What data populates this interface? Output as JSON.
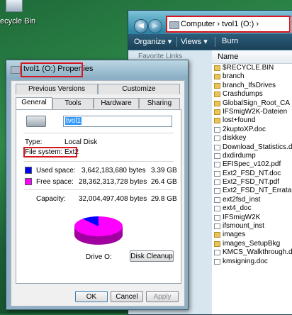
{
  "desktop": {
    "recycle_bin_label": "ecycle Bin"
  },
  "explorer": {
    "address_path": "Computer  ›  tvol1 (O:)  ›",
    "toolbar": {
      "organize": "Organize ▾",
      "views": "Views ▾",
      "burn": "Burn"
    },
    "favorite_links_label": "Favorite Links",
    "column_name": "Name",
    "files": [
      {
        "name": "$RECYCLE.BIN",
        "icon": "folder"
      },
      {
        "name": "branch",
        "icon": "folder"
      },
      {
        "name": "branch_IfsDrives",
        "icon": "folder"
      },
      {
        "name": "Crashdumps",
        "icon": "folder"
      },
      {
        "name": "GlobalSign_Root_CA",
        "icon": "folder"
      },
      {
        "name": "IFSmigW2K-Dateien",
        "icon": "folder"
      },
      {
        "name": "lost+found",
        "icon": "folder"
      },
      {
        "name": "2kuptoXP.doc",
        "icon": "doc"
      },
      {
        "name": "diskkey",
        "icon": "doc"
      },
      {
        "name": "Download_Statistics.doc",
        "icon": "doc"
      },
      {
        "name": "dxdirdump",
        "icon": "doc"
      },
      {
        "name": "EFISpec_v102.pdf",
        "icon": "doc"
      },
      {
        "name": "Ext2_FSD_NT.doc",
        "icon": "doc"
      },
      {
        "name": "Ext2_FSD_NT.pdf",
        "icon": "doc"
      },
      {
        "name": "Ext2_FSD_NT_Errata",
        "icon": "doc"
      },
      {
        "name": "ext2fsd_inst",
        "icon": "doc"
      },
      {
        "name": "ext4_doc",
        "icon": "doc"
      },
      {
        "name": "IFSmigW2K",
        "icon": "doc"
      },
      {
        "name": "ifsmount_inst",
        "icon": "doc"
      },
      {
        "name": "images",
        "icon": "folder"
      },
      {
        "name": "images_SetupBkg",
        "icon": "folder"
      },
      {
        "name": "KMCS_Walkthrough.doc",
        "icon": "doc"
      },
      {
        "name": "kmsigning.doc",
        "icon": "doc"
      }
    ]
  },
  "dialog": {
    "title": "tvol1 (O:) Properties",
    "tabs_row1": [
      "Previous Versions",
      "Customize"
    ],
    "tabs_row2": [
      "General",
      "Tools",
      "Hardware",
      "Sharing"
    ],
    "active_tab": "General",
    "volume_name": "tvol1",
    "type_label": "Type:",
    "type_value": "Local Disk",
    "fs_label": "File system:",
    "fs_value": "Ext2",
    "used_label": "Used space:",
    "used_bytes": "3,642,183,680 bytes",
    "used_size": "3.39 GB",
    "free_label": "Free space:",
    "free_bytes": "28,362,313,728 bytes",
    "free_size": "26.4 GB",
    "capacity_label": "Capacity:",
    "capacity_bytes": "32,004,497,408 bytes",
    "capacity_size": "29.8 GB",
    "drive_label": "Drive O:",
    "disk_cleanup": "Disk Cleanup",
    "ok": "OK",
    "cancel": "Cancel",
    "apply": "Apply",
    "used_fraction": 0.114,
    "colors": {
      "used": "#0000ff",
      "free": "#ff00ff"
    }
  }
}
